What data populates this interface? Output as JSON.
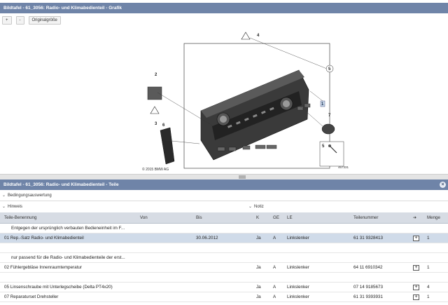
{
  "graphic_panel": {
    "title": "Bildtafel - 61_3056: Radio- und Klimabedienteil - Grafik",
    "toolbar": {
      "zoom_in": "+",
      "zoom_out": "-",
      "original_size": "Originalgröße"
    },
    "copyright": "© 2015 BMW AG",
    "image_id": "467331",
    "callouts": [
      "1",
      "2",
      "3",
      "4",
      "5",
      "6",
      "7",
      "5"
    ]
  },
  "parts_panel": {
    "title": "Bildtafel - 61_3056: Radio- und Klimabedienteil - Teile",
    "close": "×",
    "sections": {
      "bedingung": "Bedingungsauswertung",
      "hinweis": "Hinweis",
      "notiz": "Notiz"
    },
    "columns": {
      "name": "Teile-Benennung",
      "von": "Von",
      "bis": "Bis",
      "k": "K",
      "ge": "GE",
      "le": "LE",
      "teilenummer": "Teilenummer",
      "arrow": "➔",
      "menge": "Menge"
    },
    "rows": [
      {
        "type": "note",
        "text": "Entgegen der ursprünglich verbauten Bedieneinheit im F..."
      },
      {
        "type": "part",
        "name": "01 Rep.-Satz Radio- und Klimabedienteil",
        "von": "",
        "bis": "30.06.2012",
        "k": "Ja",
        "ge": "A",
        "le": "Linkslenker",
        "teilenummer": "61 31 9328413",
        "plus": "+",
        "menge": "1"
      },
      {
        "type": "blank"
      },
      {
        "type": "note",
        "text": "nur passend für die Radio- und Klimabedienteile der erst..."
      },
      {
        "type": "part",
        "name": "02 Fühlergebläse Innenraumtemperatur",
        "von": "",
        "bis": "",
        "k": "Ja",
        "ge": "A",
        "le": "Linkslenker",
        "teilenummer": "64 11 6910342",
        "plus": "+",
        "menge": "1"
      },
      {
        "type": "blank"
      },
      {
        "type": "part",
        "name": "05 Linsenschraube mit Unterlegscheibe (Delta PT4x20)",
        "von": "",
        "bis": "",
        "k": "Ja",
        "ge": "A",
        "le": "Linkslenker",
        "teilenummer": "07 14 9185673",
        "plus": "+",
        "menge": "4"
      },
      {
        "type": "part",
        "name": "07 Reparaturset Drehsteller",
        "von": "",
        "bis": "",
        "k": "Ja",
        "ge": "A",
        "le": "Linkslenker",
        "teilenummer": "61 31 9393931",
        "plus": "+",
        "menge": "1"
      }
    ]
  }
}
